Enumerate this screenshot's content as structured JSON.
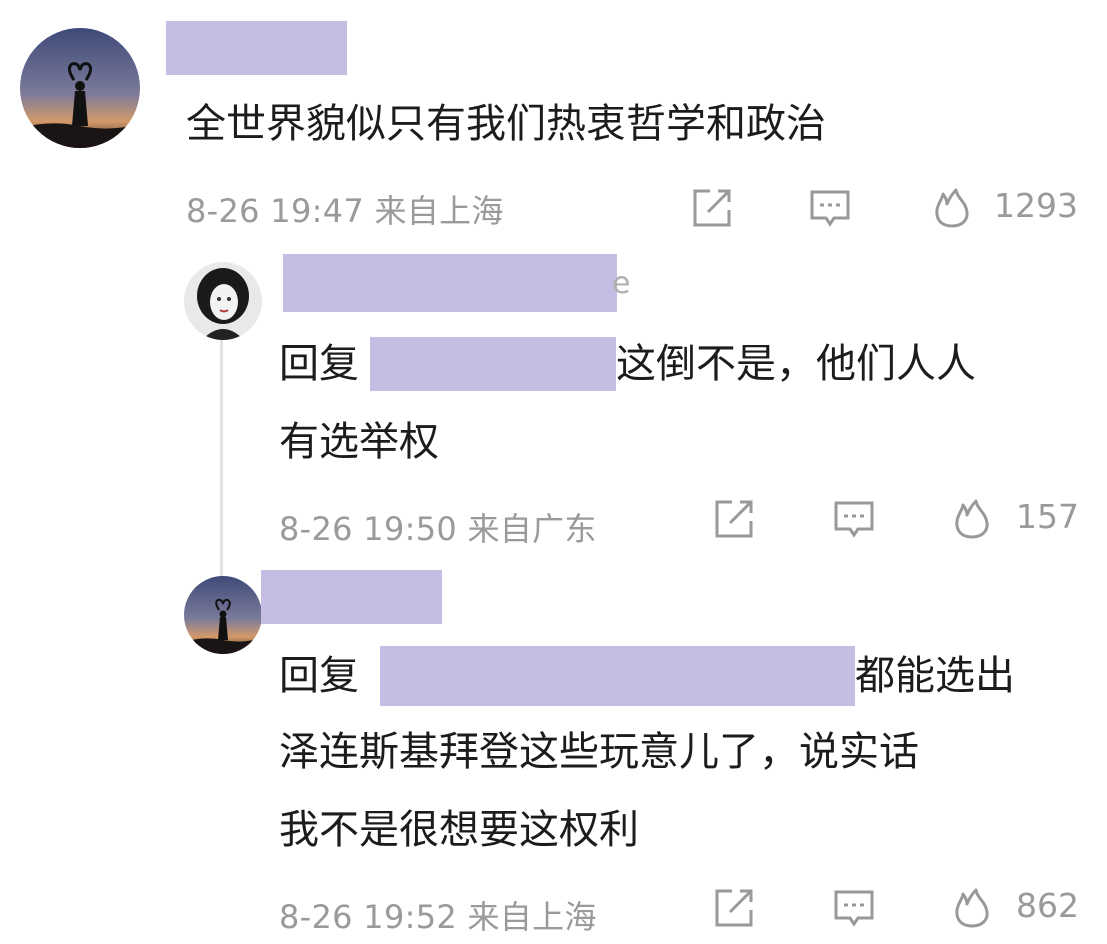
{
  "comments": [
    {
      "text": "全世界貌似只有我们热衷哲学和政治",
      "meta": "8-26 19:47 来自上海",
      "likes": "1293"
    },
    {
      "reply_prefix": "回复",
      "text_line1": "这倒不是，他们人人",
      "text_line2": "有选举权",
      "meta": "8-26 19:50 来自广东",
      "likes": "157"
    },
    {
      "reply_prefix": "回复",
      "text_line1": "都能选出",
      "text_line2": "泽连斯基拜登这些玩意儿了，说实话",
      "text_line3": "我不是很想要这权利",
      "meta": "8-26 19:52 来自上海",
      "likes": "862"
    }
  ],
  "icons": {
    "share": "share-icon",
    "comment": "comment-icon",
    "like": "flame-icon"
  },
  "colors": {
    "redaction": "#c5bde3",
    "meta_text": "#9a9a9a",
    "main_text": "#1c1c1c"
  }
}
